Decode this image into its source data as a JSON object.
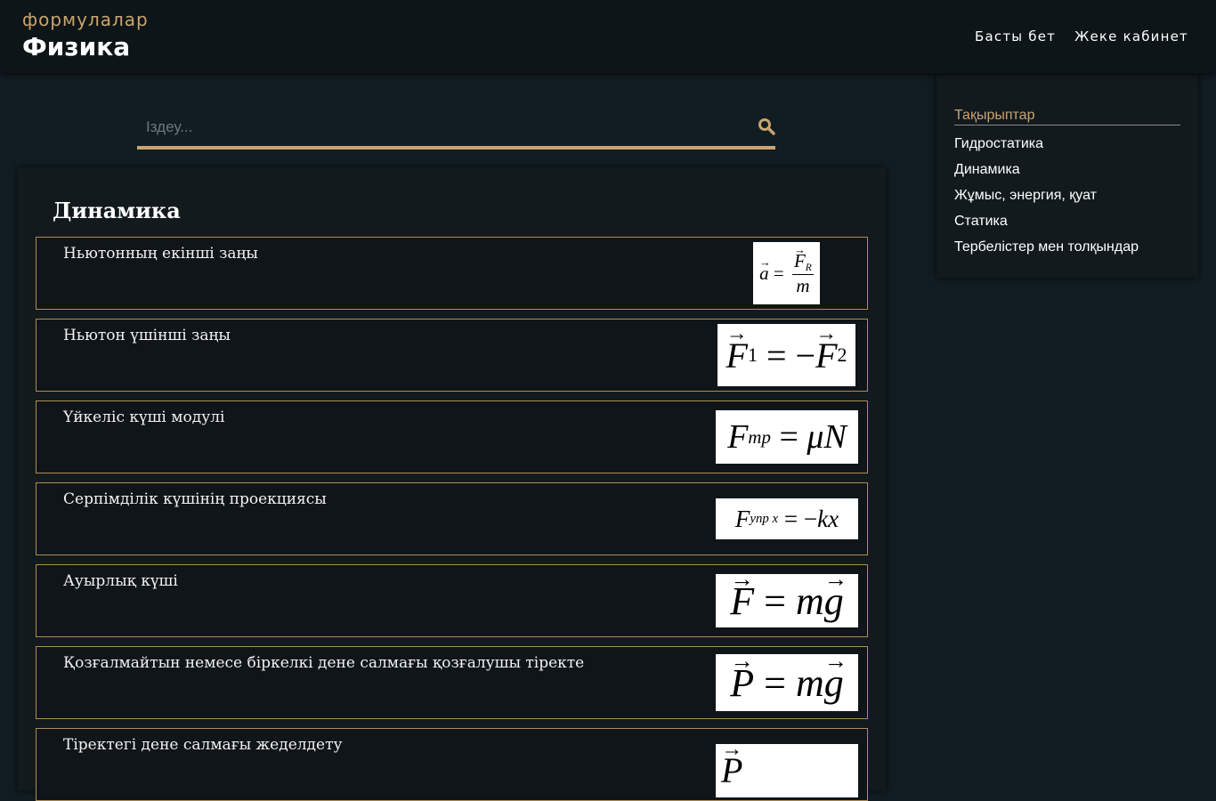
{
  "header": {
    "subtitle": "формулалар",
    "title": "Физика",
    "nav": [
      "Басты бет",
      "Жеке кабинет"
    ]
  },
  "search": {
    "placeholder": "Іздеу..."
  },
  "main": {
    "title": "Динамика",
    "formulas": [
      {
        "label": "Ньютонның екінші заңы"
      },
      {
        "label": "Ньютон үшінші заңы"
      },
      {
        "label": "Үйкеліс күші модулі"
      },
      {
        "label": "Серпімділік күшінің проекциясы"
      },
      {
        "label": "Ауырлық күші"
      },
      {
        "label": "Қозғалмайтын немесе біркелкі дене салмағы қозғалушы тіректе"
      },
      {
        "label": "Тіректегі дене салмағы жеделдету"
      }
    ]
  },
  "sidebar": {
    "heading": "Тақырыптар",
    "items": [
      "Гидростатика",
      "Динамика",
      "Жұмыс, энергия, қуат",
      "Статика",
      "Тербелістер мен толқындар"
    ]
  },
  "colors": {
    "accent": "#c9a46e",
    "background": "#111d22",
    "header": "#0d1518",
    "card": "#121a1e"
  },
  "icons": {
    "search": "search-icon"
  }
}
